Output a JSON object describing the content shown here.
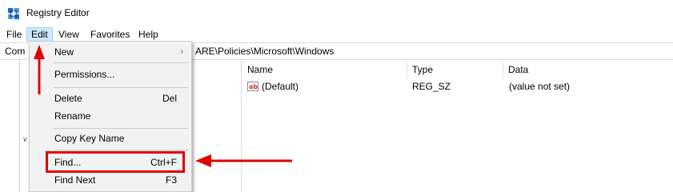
{
  "window": {
    "title": "Registry Editor"
  },
  "menubar": {
    "items": [
      "File",
      "Edit",
      "View",
      "Favorites",
      "Help"
    ],
    "active": "Edit"
  },
  "address": {
    "left_text": "Com",
    "right_text": "ARE\\Policies\\Microsoft\\Windows"
  },
  "list": {
    "columns": [
      "Name",
      "Type",
      "Data"
    ],
    "rows": [
      {
        "name": "(Default)",
        "type": "REG_SZ",
        "data": "(value not set)"
      }
    ]
  },
  "edit_menu": {
    "new": "New",
    "permissions": "Permissions...",
    "delete": "Delete",
    "delete_shortcut": "Del",
    "rename": "Rename",
    "copy_key_name": "Copy Key Name",
    "find": "Find...",
    "find_shortcut": "Ctrl+F",
    "find_next": "Find Next",
    "find_next_shortcut": "F3"
  },
  "colors": {
    "annotation_red": "#e00000",
    "menu_active_bg": "#cce8ff",
    "menu_bg": "#f2f2f2"
  },
  "icons": [
    "regedit-app-icon",
    "string-value-ab-icon",
    "submenu-arrow-icon",
    "tree-expander-icon"
  ]
}
